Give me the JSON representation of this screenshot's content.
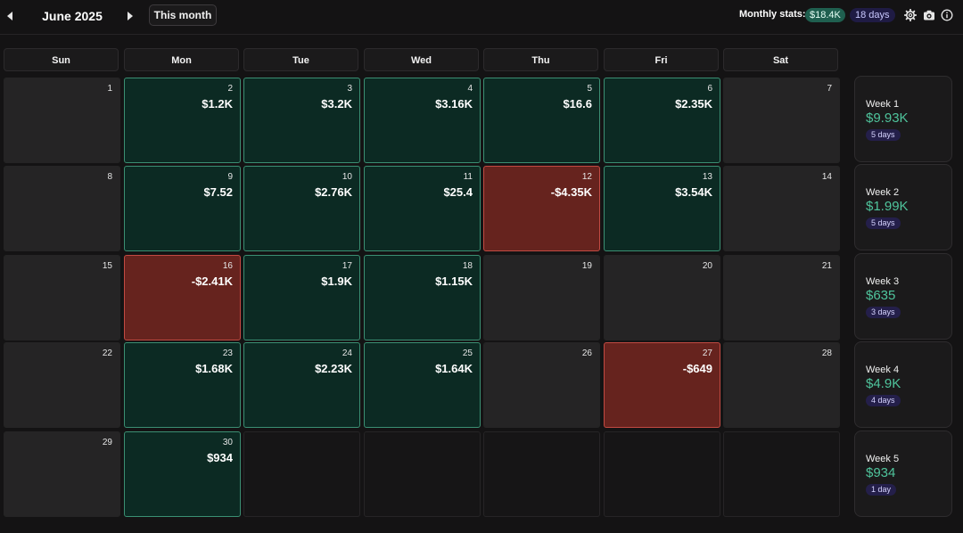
{
  "header": {
    "month_title": "June 2025",
    "this_month_label": "This month",
    "stats_label": "Monthly stats:",
    "stats_amount": "$18.4K",
    "stats_days": "18 days",
    "icons": [
      "prev-arrow-icon",
      "next-arrow-icon",
      "gear-icon",
      "camera-icon",
      "info-icon"
    ]
  },
  "weekdays": [
    "Sun",
    "Mon",
    "Tue",
    "Wed",
    "Thu",
    "Fri",
    "Sat"
  ],
  "weeks": [
    {
      "days": [
        {
          "date": "1",
          "amount": "",
          "state": "neutral"
        },
        {
          "date": "2",
          "amount": "$1.2K",
          "state": "profit"
        },
        {
          "date": "3",
          "amount": "$3.2K",
          "state": "profit"
        },
        {
          "date": "4",
          "amount": "$3.16K",
          "state": "profit"
        },
        {
          "date": "5",
          "amount": "$16.6",
          "state": "profit"
        },
        {
          "date": "6",
          "amount": "$2.35K",
          "state": "profit"
        },
        {
          "date": "7",
          "amount": "",
          "state": "neutral"
        }
      ]
    },
    {
      "days": [
        {
          "date": "8",
          "amount": "",
          "state": "neutral"
        },
        {
          "date": "9",
          "amount": "$7.52",
          "state": "profit"
        },
        {
          "date": "10",
          "amount": "$2.76K",
          "state": "profit"
        },
        {
          "date": "11",
          "amount": "$25.4",
          "state": "profit"
        },
        {
          "date": "12",
          "amount": "-$4.35K",
          "state": "loss"
        },
        {
          "date": "13",
          "amount": "$3.54K",
          "state": "profit"
        },
        {
          "date": "14",
          "amount": "",
          "state": "neutral"
        }
      ]
    },
    {
      "days": [
        {
          "date": "15",
          "amount": "",
          "state": "neutral"
        },
        {
          "date": "16",
          "amount": "-$2.41K",
          "state": "loss"
        },
        {
          "date": "17",
          "amount": "$1.9K",
          "state": "profit"
        },
        {
          "date": "18",
          "amount": "$1.15K",
          "state": "profit"
        },
        {
          "date": "19",
          "amount": "",
          "state": "neutral"
        },
        {
          "date": "20",
          "amount": "",
          "state": "neutral"
        },
        {
          "date": "21",
          "amount": "",
          "state": "neutral"
        }
      ]
    },
    {
      "days": [
        {
          "date": "22",
          "amount": "",
          "state": "neutral"
        },
        {
          "date": "23",
          "amount": "$1.68K",
          "state": "profit"
        },
        {
          "date": "24",
          "amount": "$2.23K",
          "state": "profit"
        },
        {
          "date": "25",
          "amount": "$1.64K",
          "state": "profit"
        },
        {
          "date": "26",
          "amount": "",
          "state": "neutral"
        },
        {
          "date": "27",
          "amount": "-$649",
          "state": "loss"
        },
        {
          "date": "28",
          "amount": "",
          "state": "neutral"
        }
      ]
    },
    {
      "days": [
        {
          "date": "29",
          "amount": "",
          "state": "neutral"
        },
        {
          "date": "30",
          "amount": "$934",
          "state": "profit"
        },
        {
          "date": "",
          "amount": "",
          "state": "empty"
        },
        {
          "date": "",
          "amount": "",
          "state": "empty"
        },
        {
          "date": "",
          "amount": "",
          "state": "empty"
        },
        {
          "date": "",
          "amount": "",
          "state": "empty"
        },
        {
          "date": "",
          "amount": "",
          "state": "empty"
        }
      ]
    }
  ],
  "week_summaries": [
    {
      "label": "Week 1",
      "amount": "$9.93K",
      "days": "5 days"
    },
    {
      "label": "Week 2",
      "amount": "$1.99K",
      "days": "5 days"
    },
    {
      "label": "Week 3",
      "amount": "$635",
      "days": "3 days"
    },
    {
      "label": "Week 4",
      "amount": "$4.9K",
      "days": "4 days"
    },
    {
      "label": "Week 5",
      "amount": "$934",
      "days": "1 day"
    }
  ],
  "colors": {
    "profit": "#0c2a23",
    "profit_border": "#3b8f73",
    "loss": "#66231e",
    "loss_border": "#c24a42",
    "neutral": "#252425",
    "accent_green": "#4fc49c"
  }
}
